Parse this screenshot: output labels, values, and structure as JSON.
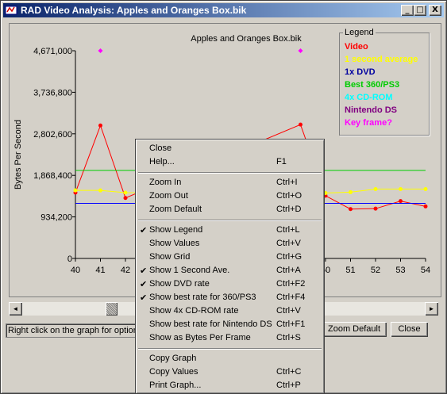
{
  "window": {
    "title": "RAD Video Analysis: Apples and Oranges Box.bik",
    "minimize_glyph": "_",
    "maximize_glyph": "□",
    "close_glyph": "X"
  },
  "chart_data": {
    "type": "line",
    "title": "Apples and Oranges Box.bik",
    "ylabel": "Bytes Per Second",
    "xlabel": "",
    "x_ticks": [
      "40",
      "41",
      "42",
      "50",
      "51",
      "52",
      "53",
      "54"
    ],
    "y_ticks": [
      "4,671,000",
      "3,736,800",
      "2,802,600",
      "1,868,400",
      "934,200",
      "0"
    ],
    "ylim": [
      0,
      4671000
    ],
    "xlim": [
      40,
      54
    ],
    "series": [
      {
        "name": "Video",
        "color": "#ff0000",
        "x": [
          40,
          41,
          42,
          49,
          50,
          51,
          52,
          53,
          54
        ],
        "y": [
          1480000,
          2990000,
          1360000,
          3010000,
          1410000,
          1110000,
          1120000,
          1290000,
          1170000
        ]
      },
      {
        "name": "1 second average",
        "color": "#ffff00",
        "x": [
          40,
          41,
          42,
          50,
          51,
          52,
          53,
          54
        ],
        "y": [
          1530000,
          1530000,
          1480000,
          1470000,
          1490000,
          1560000,
          1560000,
          1560000
        ]
      },
      {
        "name": "1x DVD",
        "color": "#0000ff",
        "x": [
          40,
          54
        ],
        "y": [
          1240000,
          1240000
        ]
      },
      {
        "name": "Best 360/PS3",
        "color": "#00cc00",
        "x": [
          40,
          54
        ],
        "y": [
          1980000,
          1980000
        ]
      }
    ],
    "key_frames": {
      "name": "Key frame?",
      "color": "#ff00ff",
      "x": [
        41,
        49
      ],
      "y": [
        4671000,
        4671000
      ]
    },
    "legend_placement": "top-right",
    "grid": false
  },
  "legend": {
    "title": "Legend",
    "items": [
      {
        "label": "Video",
        "color": "#ff0000"
      },
      {
        "label": "1 second average",
        "color": "#ffff00"
      },
      {
        "label": "1x DVD",
        "color": "#0000a0"
      },
      {
        "label": "Best 360/PS3",
        "color": "#00cc00"
      },
      {
        "label": "4x CD-ROM",
        "color": "#00ffff"
      },
      {
        "label": "Nintendo DS",
        "color": "#800080"
      },
      {
        "label": "Key frame?",
        "color": "#ff00ff"
      }
    ]
  },
  "scrollbar": {
    "left_glyph": "◄",
    "right_glyph": "►",
    "position_fraction": 0.23
  },
  "status": {
    "hint": "Right click on the graph for options",
    "zoom_default_button": "Zoom Default",
    "close_button": "Close"
  },
  "menu": {
    "items": [
      {
        "label": "Close",
        "shortcut": "",
        "checked": false
      },
      {
        "label": "Help...",
        "shortcut": "F1",
        "checked": false
      },
      {
        "label": "Zoom In",
        "shortcut": "Ctrl+I",
        "checked": false
      },
      {
        "label": "Zoom Out",
        "shortcut": "Ctrl+O",
        "checked": false
      },
      {
        "label": "Zoom Default",
        "shortcut": "Ctrl+D",
        "checked": false
      },
      {
        "label": "Show Legend",
        "shortcut": "Ctrl+L",
        "checked": true
      },
      {
        "label": "Show Values",
        "shortcut": "Ctrl+V",
        "checked": false
      },
      {
        "label": "Show Grid",
        "shortcut": "Ctrl+G",
        "checked": false
      },
      {
        "label": "Show 1 Second Ave.",
        "shortcut": "Ctrl+A",
        "checked": true
      },
      {
        "label": "Show DVD rate",
        "shortcut": "Ctrl+F2",
        "checked": true
      },
      {
        "label": "Show best rate for 360/PS3",
        "shortcut": "Ctrl+F4",
        "checked": true
      },
      {
        "label": "Show 4x CD-ROM rate",
        "shortcut": "Ctrl+V",
        "checked": false
      },
      {
        "label": "Show best rate for Nintendo DS",
        "shortcut": "Ctrl+F1",
        "checked": false
      },
      {
        "label": "Show as Bytes Per Frame",
        "shortcut": "Ctrl+S",
        "checked": false
      },
      {
        "label": "Copy Graph",
        "shortcut": "",
        "checked": false
      },
      {
        "label": "Copy Values",
        "shortcut": "Ctrl+C",
        "checked": false
      },
      {
        "label": "Print Graph...",
        "shortcut": "Ctrl+P",
        "checked": false
      }
    ]
  },
  "check_glyph": "✔"
}
